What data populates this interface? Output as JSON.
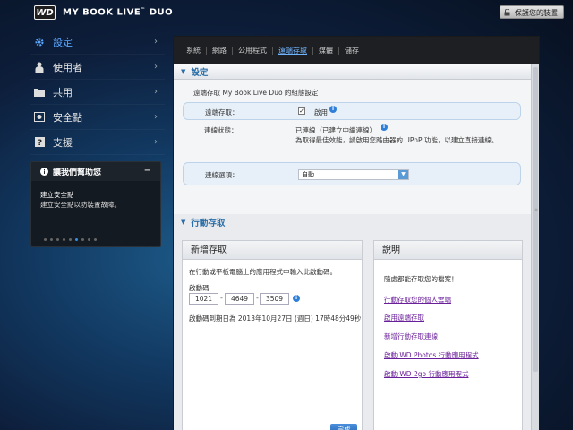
{
  "header": {
    "logo_text": "WD",
    "product_name": "MY BOOK",
    "product_live": "LIVE",
    "product_tm": "™",
    "product_duo": "DUO",
    "protect_button": "保護您的裝置"
  },
  "sidebar": {
    "items": [
      {
        "label": "設定",
        "icon": "gear-icon"
      },
      {
        "label": "使用者",
        "icon": "user-icon"
      },
      {
        "label": "共用",
        "icon": "folder-icon"
      },
      {
        "label": "安全點",
        "icon": "safepoint-icon"
      },
      {
        "label": "支援",
        "icon": "question-icon"
      }
    ],
    "chevron": "›"
  },
  "help": {
    "title": "讓我們幫助您",
    "minus": "−",
    "topic_title": "建立安全點",
    "topic_text": "建立安全點以防裝置故障。"
  },
  "tabs": [
    "系統",
    "網路",
    "公用程式",
    "遠端存取",
    "媒體",
    "儲存"
  ],
  "settings": {
    "title": "設定",
    "description": "遠端存取 My Book Live Duo 的組態設定",
    "remote_access_label": "遠端存取：",
    "remote_access_check": "✓",
    "remote_access_value": "啟用",
    "connection_status_label": "連線狀態：",
    "connection_status_value": "已連線（已建立中繼連線）",
    "connection_status_note": "為取得最佳效能，請啟用您路由器的 UPnP 功能，以建立直接連線。",
    "connection_option_label": "連線選項：",
    "connection_option_value": "自動"
  },
  "mobile": {
    "title": "行動存取",
    "add_panel": {
      "title": "新增存取",
      "instruction": "在行動或平板電腦上的應用程式中輸入此啟動碼。",
      "code_label": "啟動碼",
      "codes": [
        "1021",
        "4649",
        "3509"
      ],
      "expiry": "啟動碼到期日為 2013年10月27日 (週日) 17時48分49秒",
      "finish_button": "完成"
    },
    "help_panel": {
      "title": "說明",
      "intro": "隨處都能存取您的檔案！",
      "links": [
        "行動存取您的個人雲端",
        "啟用遠端存取",
        "新增行動存取連線",
        "啟動 WD Photos 行動應用程式",
        "啟動 WD 2go 行動應用程式"
      ]
    }
  },
  "colors": {
    "accent": "#2b6ea7",
    "active_nav": "#5aa7ff",
    "link": "#6a1f9a",
    "info": "#2f7fd8"
  }
}
